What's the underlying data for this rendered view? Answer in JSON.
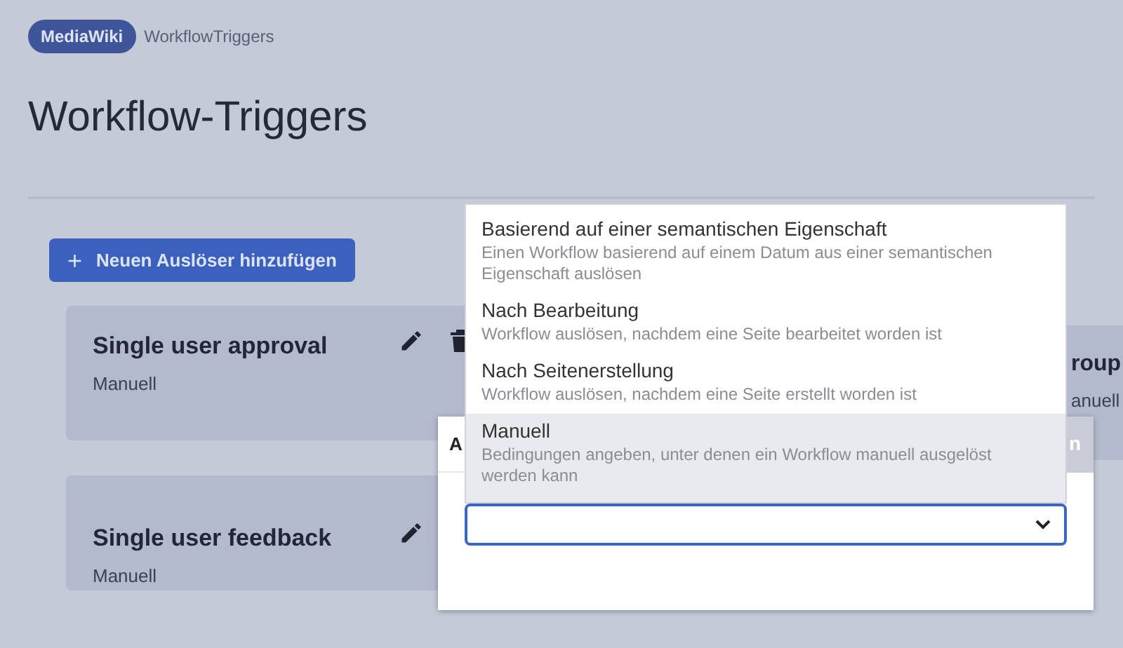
{
  "breadcrumb": {
    "badge": "MediaWiki",
    "page": "WorkflowTriggers"
  },
  "title": "Workflow-Triggers",
  "add_button": {
    "icon": "+",
    "label": "Neuen Auslöser hinzufügen"
  },
  "triggers": [
    {
      "title": "Single user approval",
      "type": "Manuell",
      "kind": "full"
    },
    {
      "title": "roup",
      "type": "anuell",
      "kind": "partial"
    },
    {
      "title": "Single user feedback",
      "type": "Manuell",
      "kind": "edit-only"
    }
  ],
  "dialog": {
    "header_text": "A",
    "header_button": "n"
  },
  "dropdown": {
    "options": [
      {
        "label": "Basierend auf einer semantischen Eigenschaft",
        "description": "Einen Workflow basierend auf einem Datum aus einer semantischen Eigenschaft auslösen",
        "selected": false
      },
      {
        "label": "Nach Bearbeitung",
        "description": "Workflow auslösen, nachdem eine Seite bearbeitet worden ist",
        "selected": false
      },
      {
        "label": "Nach Seitenerstellung",
        "description": "Workflow auslösen, nachdem eine Seite erstellt worden ist",
        "selected": false
      },
      {
        "label": "Manuell",
        "description": "Bedingungen angeben, unter denen ein Workflow manuell ausgelöst werden kann",
        "selected": true
      }
    ]
  }
}
